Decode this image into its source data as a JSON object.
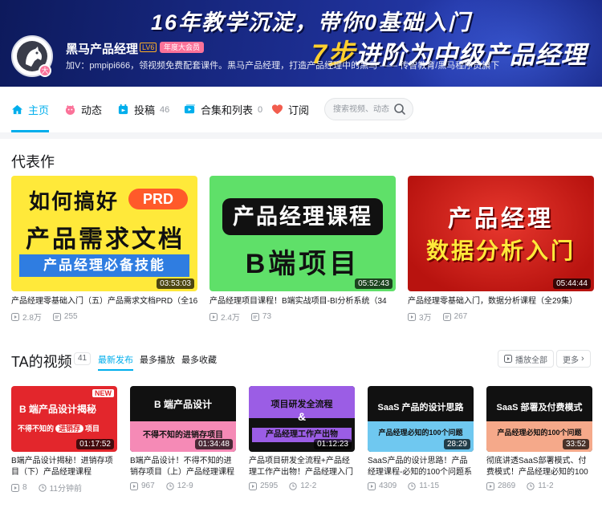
{
  "banner": {
    "slogan_line1": "16年教学沉淀，带你0基础入门",
    "slogan_line2_highlight": "7步",
    "slogan_line2_rest": "进阶为中级产品经理"
  },
  "profile": {
    "name": "黑马产品经理",
    "level": "LV6",
    "vip_label": "年度大会员",
    "avatar_badge": "大",
    "sign": "加V：pmpipi666，领视频免费配套课件。黑马产品经理，打造产品经理中的黑马 —— 传智教育/黑马程序员旗下"
  },
  "nav": {
    "items": [
      {
        "label": "主页",
        "count": "",
        "icon": "home-icon"
      },
      {
        "label": "动态",
        "count": "",
        "icon": "dynamic-icon"
      },
      {
        "label": "投稿",
        "count": "46",
        "icon": "upload-icon"
      },
      {
        "label": "合集和列表",
        "count": "0",
        "icon": "collection-icon"
      },
      {
        "label": "订阅",
        "count": "",
        "icon": "heart-icon"
      }
    ],
    "search_placeholder": "搜索视频、动态"
  },
  "masterpiece": {
    "title": "代表作",
    "cards": [
      {
        "thumb_line1": "如何搞好",
        "thumb_tag": "PRD",
        "thumb_line2": "产品需求文档",
        "thumb_line3": "产品经理必备技能",
        "duration": "03:53:03",
        "title": "产品经理零基础入门（五）产品需求文档PRD（全16",
        "plays": "2.8万",
        "danmaku": "255"
      },
      {
        "thumb_line1": "产品经理课程",
        "thumb_line2": "B端项目",
        "duration": "05:52:43",
        "title": "产品经理项目课程！B端实战项目-BI分析系统（34",
        "plays": "2.4万",
        "danmaku": "73"
      },
      {
        "thumb_line1": "产品经理",
        "thumb_line2": "数据分析入门",
        "duration": "05:44:44",
        "title": "产品经理零基础入门，数据分析课程（全29集）",
        "plays": "3万",
        "danmaku": "267"
      }
    ]
  },
  "videos": {
    "title": "TA的视频",
    "count": "41",
    "tabs": [
      "最新发布",
      "最多播放",
      "最多收藏"
    ],
    "play_all": "播放全部",
    "more": "更多",
    "cards": [
      {
        "thumb_line1": "B 端产品设计揭秘",
        "thumb_badge": "NEW",
        "thumb_line2a": "不得不知的",
        "thumb_line2b": "进销存",
        "thumb_line2c": "项目",
        "duration": "01:17:52",
        "title_line1": "B端产品设计揭秘！进销存项",
        "title_line2": "目（下）产品经理课程",
        "plays": "8",
        "time": "11分钟前"
      },
      {
        "thumb_line1": "B 端产品设计",
        "thumb_line2": "不得不知的进销存项目",
        "duration": "01:34:48",
        "title_line1": "B端产品设计！不得不知的进",
        "title_line2": "销存项目（上）产品经理课程",
        "plays": "967",
        "time": "12-9"
      },
      {
        "thumb_line1": "项目研发全流程",
        "thumb_amp": "&",
        "thumb_line2": "产品经理工作产出物",
        "duration": "01:12:23",
        "title_line1": "产品项目研发全流程+产品经",
        "title_line2": "理工作产出物！产品经理入门",
        "plays": "2595",
        "time": "12-2"
      },
      {
        "thumb_line1": "SaaS 产品的设计思路",
        "thumb_line2": "产品经理必知的100个问题",
        "duration": "28:29",
        "title_line1": "SaaS产品的设计思路！产品",
        "title_line2": "经理课程-必知的100个问题系",
        "plays": "4309",
        "time": "11-15"
      },
      {
        "thumb_line1": "SaaS 部署及付费模式",
        "thumb_line2": "产品经理必知的100个问题",
        "duration": "33:52",
        "title_line1": "彻底讲透SaaS部署模式、付",
        "title_line2": "费模式！产品经理必知的100",
        "plays": "2869",
        "time": "11-2"
      }
    ]
  },
  "colors": {
    "accent": "#00aeec",
    "pink": "#fb7299",
    "yellow_thumb": "#ffe93a",
    "green_thumb": "#5fe069",
    "red_thumb": "#d0201c"
  }
}
